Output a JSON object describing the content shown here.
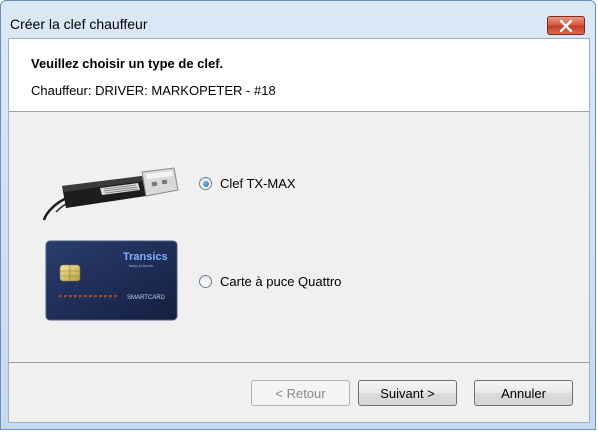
{
  "window": {
    "title": "Créer la clef chauffeur",
    "close_icon": "close-icon"
  },
  "header": {
    "title": "Veuillez choisir un type de clef.",
    "subtitle": "Chauffeur: DRIVER: MARKOPETER - #18"
  },
  "options": [
    {
      "label": "Clef TX-MAX",
      "checked": true,
      "image": "usb-key-image"
    },
    {
      "label": "Carte à puce Quattro",
      "checked": false,
      "image": "smartcard-image"
    }
  ],
  "card_text": {
    "brand": "Transics",
    "tagline": "keep in touch",
    "type": "SMARTCARD"
  },
  "buttons": {
    "back": "< Retour",
    "next": "Suivant >",
    "cancel": "Annuler"
  },
  "colors": {
    "close_button": "#c8472d",
    "radio_checked": "#1a5fa8",
    "card_bg": "#1e2f5c"
  }
}
